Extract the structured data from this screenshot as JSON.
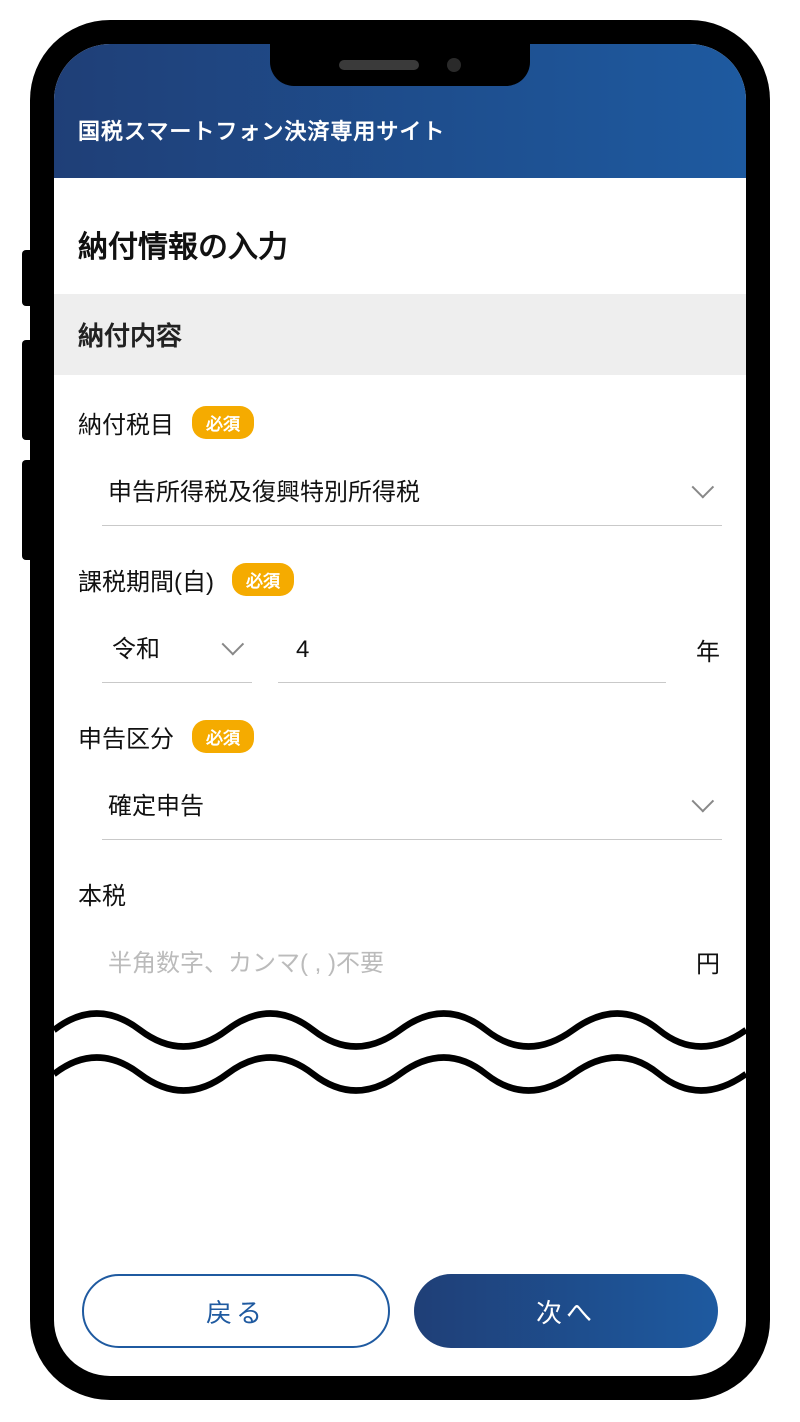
{
  "header": {
    "title": "国税スマートフォン決済専用サイト"
  },
  "page": {
    "title": "納付情報の入力"
  },
  "section": {
    "title": "納付内容"
  },
  "required_label": "必須",
  "fields": {
    "tax_item": {
      "label": "納付税目",
      "selected": "申告所得税及復興特別所得税"
    },
    "tax_period": {
      "label": "課税期間(自)",
      "era_selected": "令和",
      "year_value": "4",
      "unit": "年"
    },
    "filing_type": {
      "label": "申告区分",
      "selected": "確定申告"
    },
    "main_tax": {
      "label": "本税",
      "placeholder": "半角数字、カンマ( , )不要",
      "unit": "円"
    }
  },
  "buttons": {
    "back": "戻る",
    "next": "次へ"
  }
}
